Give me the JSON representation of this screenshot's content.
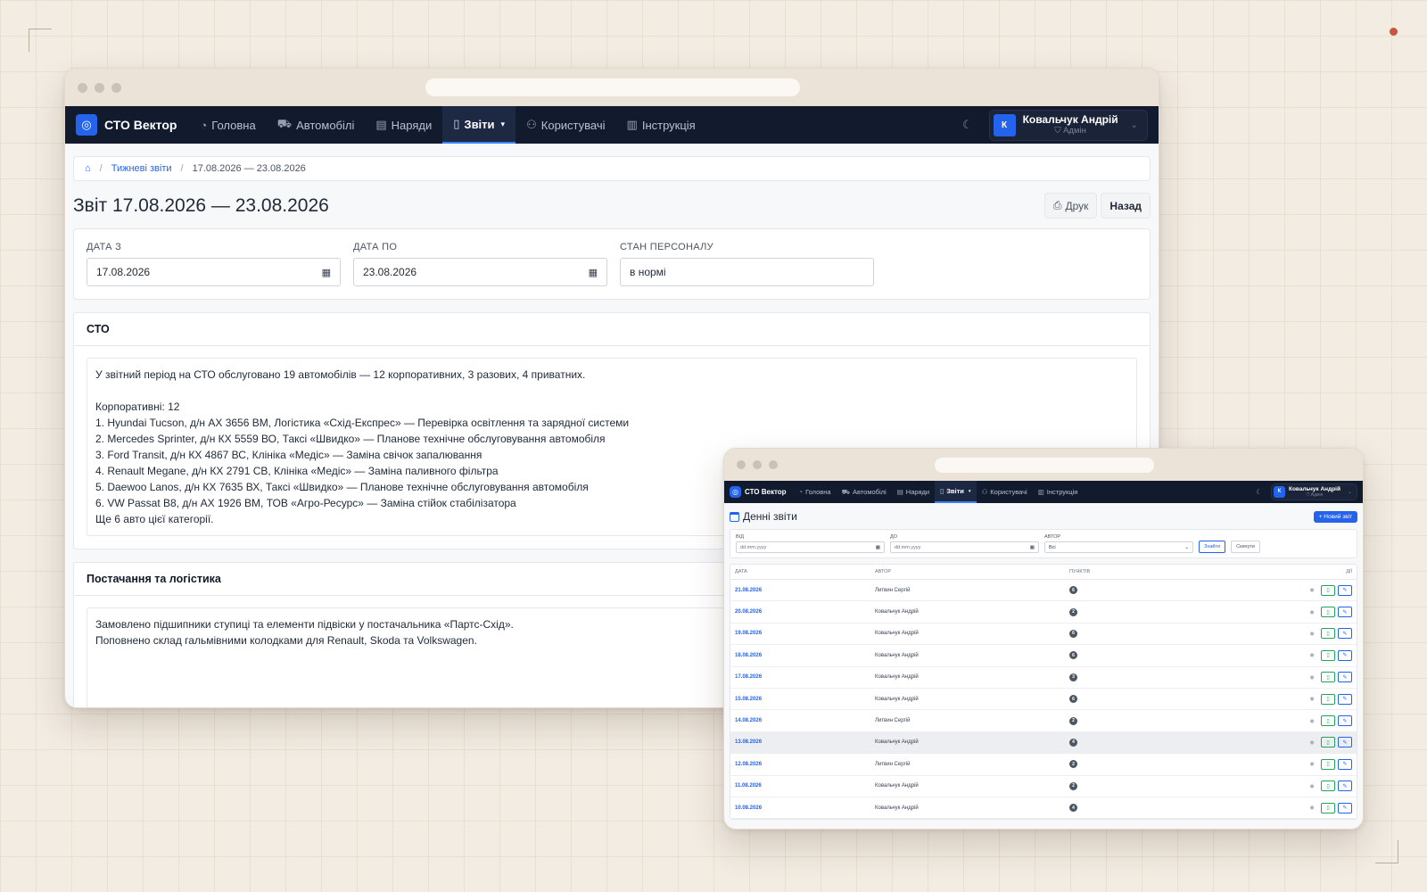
{
  "main": {
    "brand": "СТО Вектор",
    "nav": [
      {
        "label": "Головна",
        "icon": "gauge-icon"
      },
      {
        "label": "Автомобілі",
        "icon": "truck-icon"
      },
      {
        "label": "Наряди",
        "icon": "clipboard-icon"
      },
      {
        "label": "Звіти",
        "icon": "document-icon",
        "active": true
      },
      {
        "label": "Користувачі",
        "icon": "users-icon"
      },
      {
        "label": "Інструкція",
        "icon": "book-icon"
      }
    ],
    "user": {
      "initial": "К",
      "name": "Ковальчук Андрій",
      "role": "Адмін"
    },
    "breadcrumb": {
      "section": "Тижневі звіти",
      "current": "17.08.2026 — 23.08.2026"
    },
    "title": "Звіт 17.08.2026 — 23.08.2026",
    "print_label": "Друк",
    "back_label": "Назад",
    "filters": {
      "date_from_label": "ДАТА З",
      "date_from": "17.08.2026",
      "date_to_label": "ДАТА ПО",
      "date_to": "23.08.2026",
      "staff_label": "СТАН ПЕРСОНАЛУ",
      "staff_value": "в нормі"
    },
    "sections": [
      {
        "heading": "СТО",
        "text": "У звітний період на СТО обслуговано 19 автомобілів — 12 корпоративних, 3 разових, 4 приватних.\n\nКорпоративні: 12\n1. Hyundai Tucson, д/н АХ 3656 ВМ, Логістика «Схід-Експрес» — Перевірка освітлення та зарядної системи\n2. Mercedes Sprinter, д/н КХ 5559 ВО, Таксі «Швидко» — Планове технічне обслуговування автомобіля\n3. Ford Transit, д/н КХ 4867 ВС, Клініка «Медіс» — Заміна свічок запалювання\n4. Renault Megane, д/н КХ 2791 СВ, Клініка «Медіс» — Заміна паливного фільтра\n5. Daewoo Lanos, д/н КХ 7635 ВХ, Таксі «Швидко» — Планове технічне обслуговування автомобіля\n6. VW Passat B8, д/н АХ 1926 ВМ, ТОВ «Агро-Ресурс» — Заміна стійок стабілізатора\nЩе 6 авто цієї категорії."
      },
      {
        "heading": "Постачання та логістика",
        "text": "Замовлено підшипники ступиці та елементи підвіски у постачальника «Партс-Схід».\nПоповнено склад гальмівними колодками для Renault, Skoda та Volkswagen."
      }
    ]
  },
  "small": {
    "brand": "СТО Вектор",
    "nav": [
      {
        "label": "Головна"
      },
      {
        "label": "Автомобілі"
      },
      {
        "label": "Наряди"
      },
      {
        "label": "Звіти",
        "active": true
      },
      {
        "label": "Користувачі"
      },
      {
        "label": "Інструкція"
      }
    ],
    "user": {
      "initial": "К",
      "name": "Ковальчук Андрій",
      "role": "Адмін"
    },
    "title": "Денні звіти",
    "new_button": "+ Новий звіт",
    "filters": {
      "from_label": "ВІД",
      "from_placeholder": "dd.mm.yyyy",
      "to_label": "ДО",
      "to_placeholder": "dd.mm.yyyy",
      "author_label": "АВТОР",
      "author_value": "Всі",
      "find_label": "Знайти",
      "reset_label": "Скинути"
    },
    "columns": [
      "ДАТА",
      "АВТОР",
      "ПУНКТІВ",
      "ДІЇ"
    ],
    "rows": [
      {
        "date": "21.08.2026",
        "author": "Литвин Сергій",
        "count": "6"
      },
      {
        "date": "20.08.2026",
        "author": "Ковальчук Андрій",
        "count": "2"
      },
      {
        "date": "19.08.2026",
        "author": "Ковальчук Андрій",
        "count": "6"
      },
      {
        "date": "18.08.2026",
        "author": "Ковальчук Андрій",
        "count": "6"
      },
      {
        "date": "17.08.2026",
        "author": "Ковальчук Андрій",
        "count": "3"
      },
      {
        "date": "15.08.2026",
        "author": "Ковальчук Андрій",
        "count": "6"
      },
      {
        "date": "14.08.2026",
        "author": "Литвин Сергій",
        "count": "2"
      },
      {
        "date": "13.08.2026",
        "author": "Ковальчук Андрій",
        "count": "4",
        "highlight": true
      },
      {
        "date": "12.08.2026",
        "author": "Литвин Сергій",
        "count": "2"
      },
      {
        "date": "11.08.2026",
        "author": "Ковальчук Андрій",
        "count": "2"
      },
      {
        "date": "10.08.2026",
        "author": "Ковальчук Андрій",
        "count": "4"
      }
    ]
  }
}
